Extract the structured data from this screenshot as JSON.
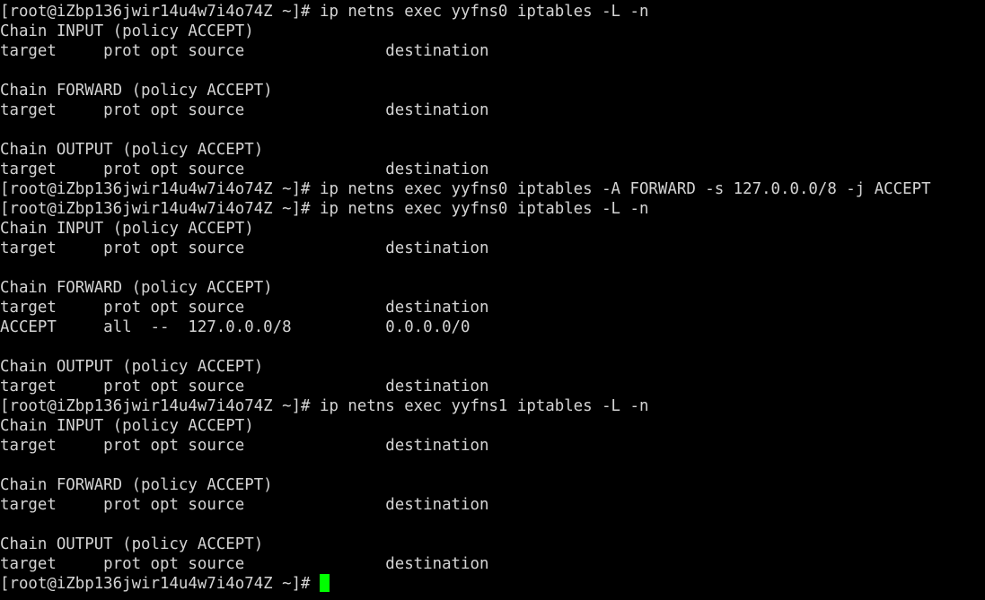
{
  "terminal": {
    "colors": {
      "background": "#000000",
      "foreground": "#d4d4d4",
      "cursor": "#00ff00"
    },
    "lines": [
      "[root@iZbp136jwir14u4w7i4o74Z ~]# ip netns exec yyfns0 iptables -L -n",
      "Chain INPUT (policy ACCEPT)",
      "target     prot opt source               destination",
      "",
      "Chain FORWARD (policy ACCEPT)",
      "target     prot opt source               destination",
      "",
      "Chain OUTPUT (policy ACCEPT)",
      "target     prot opt source               destination",
      "[root@iZbp136jwir14u4w7i4o74Z ~]# ip netns exec yyfns0 iptables -A FORWARD -s 127.0.0.0/8 -j ACCEPT",
      "[root@iZbp136jwir14u4w7i4o74Z ~]# ip netns exec yyfns0 iptables -L -n",
      "Chain INPUT (policy ACCEPT)",
      "target     prot opt source               destination",
      "",
      "Chain FORWARD (policy ACCEPT)",
      "target     prot opt source               destination",
      "ACCEPT     all  --  127.0.0.0/8          0.0.0.0/0",
      "",
      "Chain OUTPUT (policy ACCEPT)",
      "target     prot opt source               destination",
      "[root@iZbp136jwir14u4w7i4o74Z ~]# ip netns exec yyfns1 iptables -L -n",
      "Chain INPUT (policy ACCEPT)",
      "target     prot opt source               destination",
      "",
      "Chain FORWARD (policy ACCEPT)",
      "target     prot opt source               destination",
      "",
      "Chain OUTPUT (policy ACCEPT)",
      "target     prot opt source               destination"
    ],
    "prompt": "[root@iZbp136jwir14u4w7i4o74Z ~]# "
  }
}
